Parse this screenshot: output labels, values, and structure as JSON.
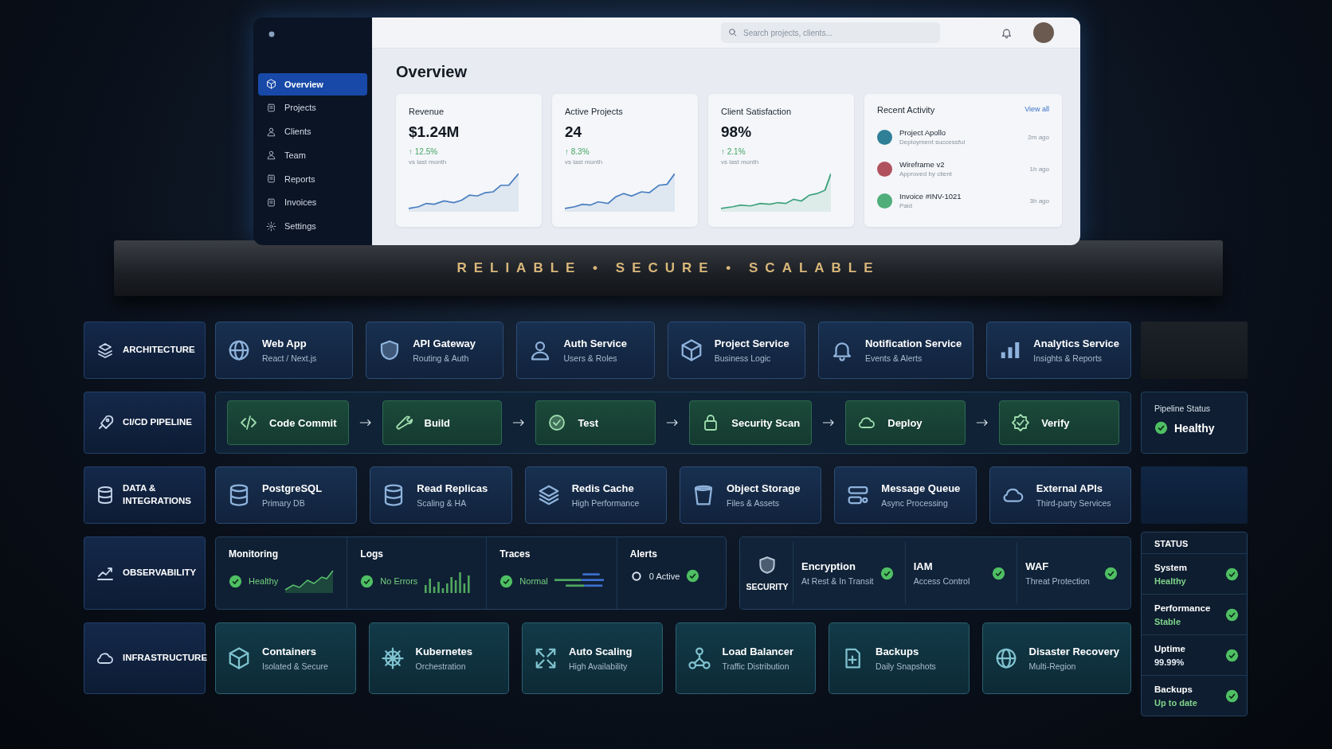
{
  "dashboard": {
    "sidebar": {
      "items": [
        {
          "label": "Overview",
          "selected": true
        },
        {
          "label": "Projects",
          "selected": false
        },
        {
          "label": "Clients",
          "selected": false
        },
        {
          "label": "Team",
          "selected": false
        },
        {
          "label": "Reports",
          "selected": false
        },
        {
          "label": "Invoices",
          "selected": false
        },
        {
          "label": "Settings",
          "selected": false
        }
      ]
    },
    "search": {
      "placeholder": "Search projects, clients..."
    },
    "title": "Overview",
    "stats": [
      {
        "label": "Revenue",
        "value": "$1.24M",
        "change": "↑ 12.5%",
        "note": "vs last month",
        "color": "#4a7fc1"
      },
      {
        "label": "Active Projects",
        "value": "24",
        "change": "↑ 8.3%",
        "note": "vs last month",
        "color": "#4a7fc1"
      },
      {
        "label": "Client Satisfaction",
        "value": "98%",
        "change": "↑ 2.1%",
        "note": "vs last month",
        "color": "#3fa37e"
      }
    ],
    "activity": {
      "title": "Recent Activity",
      "link": "View all",
      "items": [
        {
          "title": "Project Apollo",
          "subtitle": "Deployment successful",
          "time": "2m ago",
          "color": "#2f7f96"
        },
        {
          "title": "Wireframe v2",
          "subtitle": "Approved by client",
          "time": "1h ago",
          "color": "#b0525e"
        },
        {
          "title": "Invoice #INV-1021",
          "subtitle": "Paid",
          "time": "3h ago",
          "color": "#4fae7a"
        }
      ]
    }
  },
  "tagline": "RELIABLE • SECURE • SCALABLE",
  "layers": [
    {
      "kind": "services",
      "label": "ARCHITECTURE",
      "items": [
        {
          "title": "Web App",
          "subtitle": "React / Next.js"
        },
        {
          "title": "API Gateway",
          "subtitle": "Routing & Auth"
        },
        {
          "title": "Auth Service",
          "subtitle": "Users & Roles"
        },
        {
          "title": "Project Service",
          "subtitle": "Business Logic"
        },
        {
          "title": "Notification Service",
          "subtitle": "Events & Alerts"
        },
        {
          "title": "Analytics Service",
          "subtitle": "Insights & Reports"
        }
      ]
    },
    {
      "kind": "pipeline",
      "label": "CI/CD PIPELINE",
      "steps": [
        "Code Commit",
        "Build",
        "Test",
        "Security Scan",
        "Deploy",
        "Verify"
      ]
    },
    {
      "kind": "services",
      "label": "DATA & INTEGRATIONS",
      "items": [
        {
          "title": "PostgreSQL",
          "subtitle": "Primary DB"
        },
        {
          "title": "Read Replicas",
          "subtitle": "Scaling & HA"
        },
        {
          "title": "Redis Cache",
          "subtitle": "High Performance"
        },
        {
          "title": "Object Storage",
          "subtitle": "Files & Assets"
        },
        {
          "title": "Message Queue",
          "subtitle": "Async Processing"
        },
        {
          "title": "External APIs",
          "subtitle": "Third-party Services"
        }
      ]
    },
    {
      "kind": "observability",
      "label": "OBSERVABILITY",
      "items": [
        {
          "kind": "line",
          "title": "Monitoring",
          "status": "Healthy"
        },
        {
          "kind": "bars",
          "title": "Logs",
          "status": "No Errors"
        },
        {
          "kind": "traces",
          "title": "Traces",
          "status": "Normal"
        },
        {
          "kind": "alerts",
          "title": "Alerts",
          "status": "0 Active"
        }
      ],
      "security": {
        "label": "SECURITY",
        "items": [
          {
            "title": "Encryption",
            "subtitle": "At Rest & In Transit"
          },
          {
            "title": "IAM",
            "subtitle": "Access Control"
          },
          {
            "title": "WAF",
            "subtitle": "Threat Protection"
          }
        ]
      }
    },
    {
      "kind": "platform",
      "label": "INFRASTRUCTURE",
      "items": [
        {
          "title": "Containers",
          "subtitle": "Isolated & Secure"
        },
        {
          "title": "Kubernetes",
          "subtitle": "Orchestration"
        },
        {
          "title": "Auto Scaling",
          "subtitle": "High Availability"
        },
        {
          "title": "Load Balancer",
          "subtitle": "Traffic Distribution"
        },
        {
          "title": "Backups",
          "subtitle": "Daily Snapshots"
        },
        {
          "title": "Disaster Recovery",
          "subtitle": "Multi-Region"
        }
      ]
    }
  ],
  "pipeline_status": {
    "title": "Pipeline Status",
    "value": "Healthy"
  },
  "status": {
    "title": "STATUS",
    "items": [
      {
        "label": "System",
        "value": "Healthy",
        "color": "#7fd48a"
      },
      {
        "label": "Performance",
        "value": "Stable",
        "color": "#7fd48a"
      },
      {
        "label": "Uptime",
        "value": "99.99%",
        "color": "#e6edf5"
      },
      {
        "label": "Backups",
        "value": "Up to date",
        "color": "#7fd48a"
      }
    ]
  }
}
